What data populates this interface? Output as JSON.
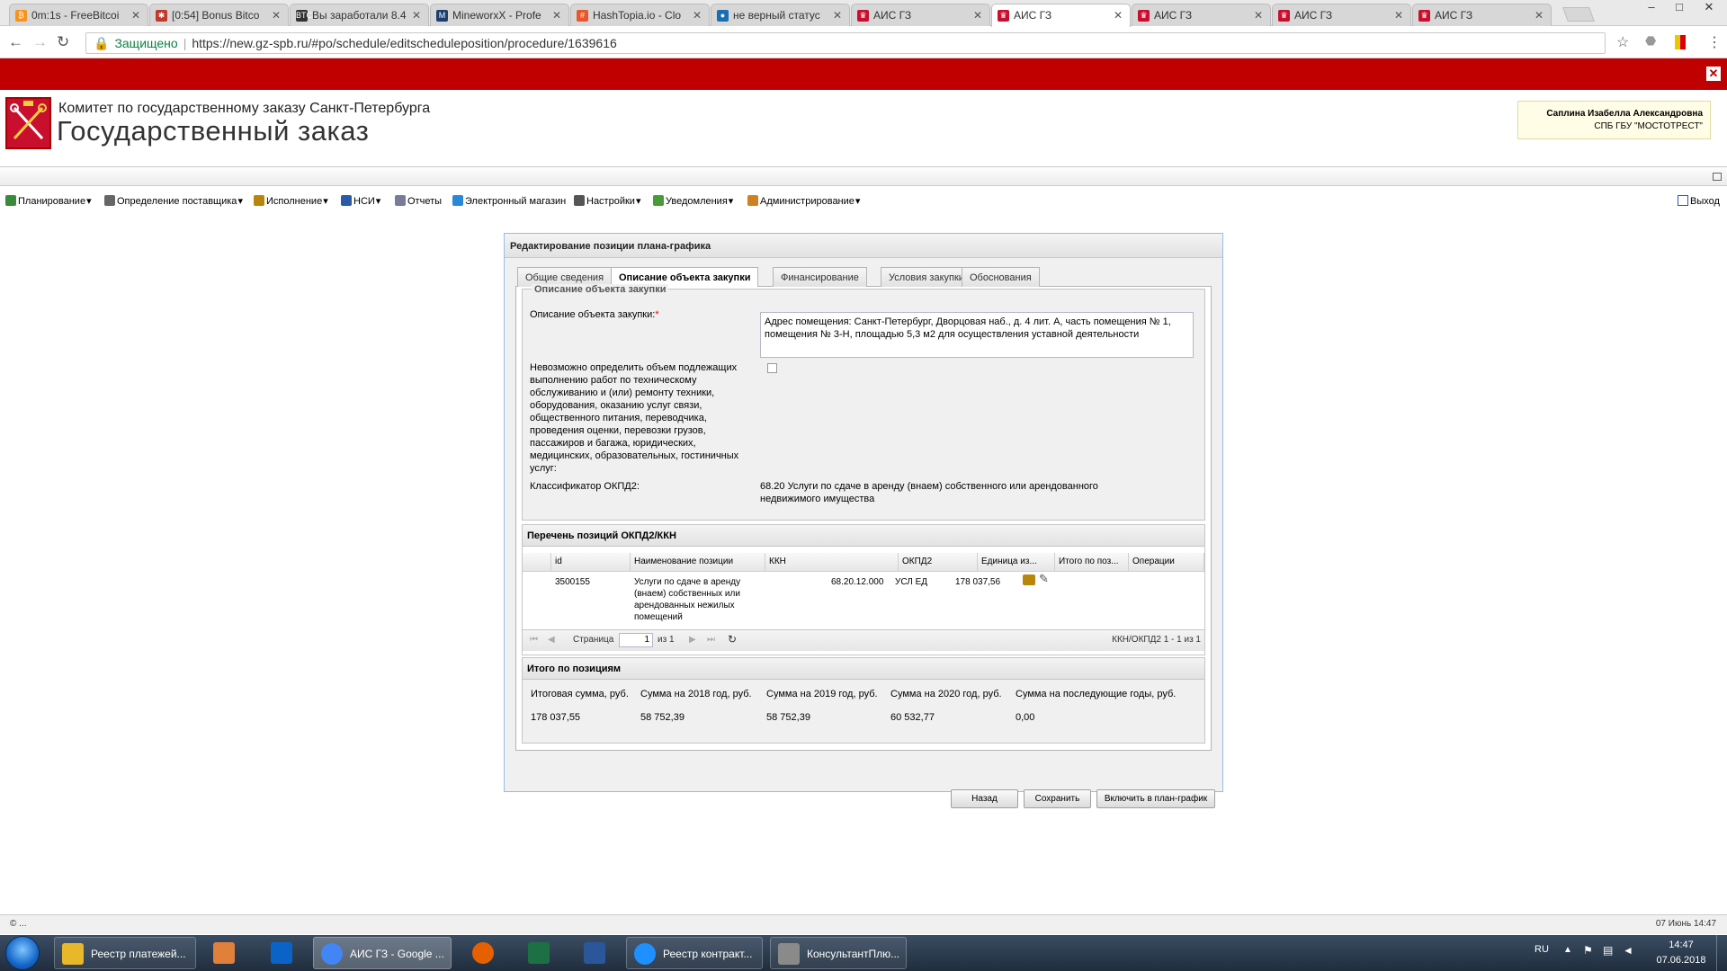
{
  "browser": {
    "tabs": [
      {
        "title": "0m:1s - FreeBitcoi",
        "color": "#f7931a",
        "glyph": "₿"
      },
      {
        "title": "[0:54] Bonus Bitco",
        "color": "#c0392b",
        "glyph": "✱"
      },
      {
        "title": "Вы заработали 8.4",
        "color": "#333333",
        "glyph": "BTC"
      },
      {
        "title": "MineworxX - Profe",
        "color": "#1c3f6e",
        "glyph": "M"
      },
      {
        "title": "HashTopia.io - Clo",
        "color": "#e6572c",
        "glyph": "#"
      },
      {
        "title": "не верный статус",
        "color": "#1a6fb3",
        "glyph": "●"
      },
      {
        "title": "АИС ГЗ",
        "color": "#c8102e",
        "glyph": "♛"
      },
      {
        "title": "АИС ГЗ",
        "color": "#c8102e",
        "glyph": "♛"
      },
      {
        "title": "АИС ГЗ",
        "color": "#c8102e",
        "glyph": "♛"
      },
      {
        "title": "АИС ГЗ",
        "color": "#c8102e",
        "glyph": "♛"
      },
      {
        "title": "АИС ГЗ",
        "color": "#c8102e",
        "glyph": "♛"
      }
    ],
    "active_tab_index": 7,
    "secure_label": "Защищено",
    "url": "https://new.gz-spb.ru/#po/schedule/editscheduleposition/procedure/1639616"
  },
  "header": {
    "org_line1": "Комитет по государственному заказу Санкт-Петербурга",
    "org_line2": "Государственный заказ",
    "user_name": "Саплина Изабелла Александровна",
    "user_org": "СПБ ГБУ \"МОСТОТРЕСТ\""
  },
  "menu": {
    "items": [
      {
        "label": "Планирование",
        "icon": "planning-icon",
        "color": "#3a8a3a",
        "dropdown": true
      },
      {
        "label": "Определение поставщика",
        "icon": "gears-icon",
        "color": "#666666",
        "dropdown": true
      },
      {
        "label": "Исполнение",
        "icon": "briefcase-icon",
        "color": "#b8860b",
        "dropdown": true
      },
      {
        "label": "НСИ",
        "icon": "book-icon",
        "color": "#2a5aa8",
        "dropdown": true
      },
      {
        "label": "Отчеты",
        "icon": "report-icon",
        "color": "#7a7a9a",
        "dropdown": false
      },
      {
        "label": "Электронный магазин",
        "icon": "shop-icon",
        "color": "#2a88d8",
        "dropdown": false
      },
      {
        "label": "Настройки",
        "icon": "wrench-icon",
        "color": "#555555",
        "dropdown": true
      },
      {
        "label": "Уведомления",
        "icon": "envelope-icon",
        "color": "#4a9a3a",
        "dropdown": true
      },
      {
        "label": "Администрирование",
        "icon": "user-icon",
        "color": "#d08020",
        "dropdown": true
      }
    ],
    "exit_label": "Выход"
  },
  "form": {
    "title": "Редактирование позиции плана-графика",
    "tabs": [
      "Общие сведения",
      "Описание объекта закупки",
      "Финансирование",
      "Условия закупки",
      "Обоснования"
    ],
    "active_tab": 1,
    "fieldset_legend": "Описание объекта закупки",
    "desc_label": "Описание объекта закупки:",
    "desc_required_mark": "*",
    "desc_value": "Адрес помещения: Санкт-Петербург, Дворцовая наб., д. 4 лит. А, часть помещения № 1, помещения № 3-Н, площадью 5,3 м2 для осуществления уставной деятельности",
    "volume_label": "Невозможно определить объем подлежащих выполнению работ по техническому обслуживанию и (или) ремонту техники, оборудования, оказанию услуг связи, общественного питания, переводчика, проведения оценки, перевозки грузов, пассажиров и багажа, юридических, медицинских, образовательных, гостиничных услуг:",
    "volume_checked": false,
    "okpd_label": "Классификатор ОКПД2:",
    "okpd_value": "68.20 Услуги по сдаче в аренду (внаем) собственного или арендованного недвижимого имущества"
  },
  "grid": {
    "title": "Перечень позиций ОКПД2/ККН",
    "columns": [
      "id",
      "Наименование позиции",
      "ККН",
      "ОКПД2",
      "Единица из...",
      "Итого по поз...",
      "Операции"
    ],
    "rows": [
      {
        "id": "3500155",
        "name": "Услуги по сдаче в аренду (внаем) собственных или арендованных нежилых помещений",
        "kkn": "",
        "okpd2": "68.20.12.000",
        "unit": "УСЛ ЕД",
        "total": "178 037,56"
      }
    ],
    "pager": {
      "page_label": "Страница",
      "page": "1",
      "of_label": "из 1",
      "summary": "ККН/ОКПД2 1 - 1 из 1"
    }
  },
  "totals": {
    "title": "Итого по позициям",
    "headers": [
      "Итоговая сумма, руб.",
      "Сумма на 2018 год, руб.",
      "Сумма на 2019 год, руб.",
      "Сумма на 2020 год, руб.",
      "Сумма на последующие годы, руб."
    ],
    "values": [
      "178 037,55",
      "58 752,39",
      "58 752,39",
      "60 532,77",
      "0,00"
    ]
  },
  "buttons": {
    "back": "Назад",
    "save": "Сохранить",
    "include": "Включить в план-график"
  },
  "statusbar": {
    "left": "© ...",
    "right": "07 Июнь 14:47"
  },
  "taskbar": {
    "windows": [
      {
        "label": "Реестр платежей...",
        "color": "#e8b82a"
      },
      {
        "label": "АИС ГЗ - Google ...",
        "color": "#4285f4"
      },
      {
        "label": "Реестр контракт...",
        "color": "#1e90ff"
      },
      {
        "label": "КонсультантПлю...",
        "color": "#8a8a8a"
      }
    ],
    "lang": "RU",
    "time": "14:47",
    "date": "07.06.2018"
  }
}
